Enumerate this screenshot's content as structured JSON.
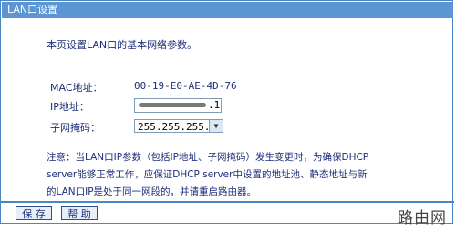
{
  "window": {
    "title": "LAN口设置"
  },
  "main": {
    "intro": "本页设置LAN口的基本网络参数。",
    "mac": {
      "label": "MAC地址：",
      "value": "00-19-E0-AE-4D-76"
    },
    "ip": {
      "label": "IP地址：",
      "visible_tail": ".1"
    },
    "subnet": {
      "label": "子网掩码：",
      "value": "255.255.255.0",
      "arrow": "▼"
    },
    "note_lines": [
      "注意：当LAN口IP参数（包括IP地址、子网掩码）发生变更时，为确保DHCP",
      "server能够正常工作，应保证DHCP server中设置的地址池、静态地址与新",
      "的LAN口IP是处于同一网段的，并请重启路由器。"
    ]
  },
  "buttons": {
    "save": "保 存",
    "help": "帮 助"
  },
  "watermark": "路由网",
  "colors": {
    "titlebar": "#5b95d4",
    "border": "#4a86c2",
    "text": "#1f2f7a"
  }
}
